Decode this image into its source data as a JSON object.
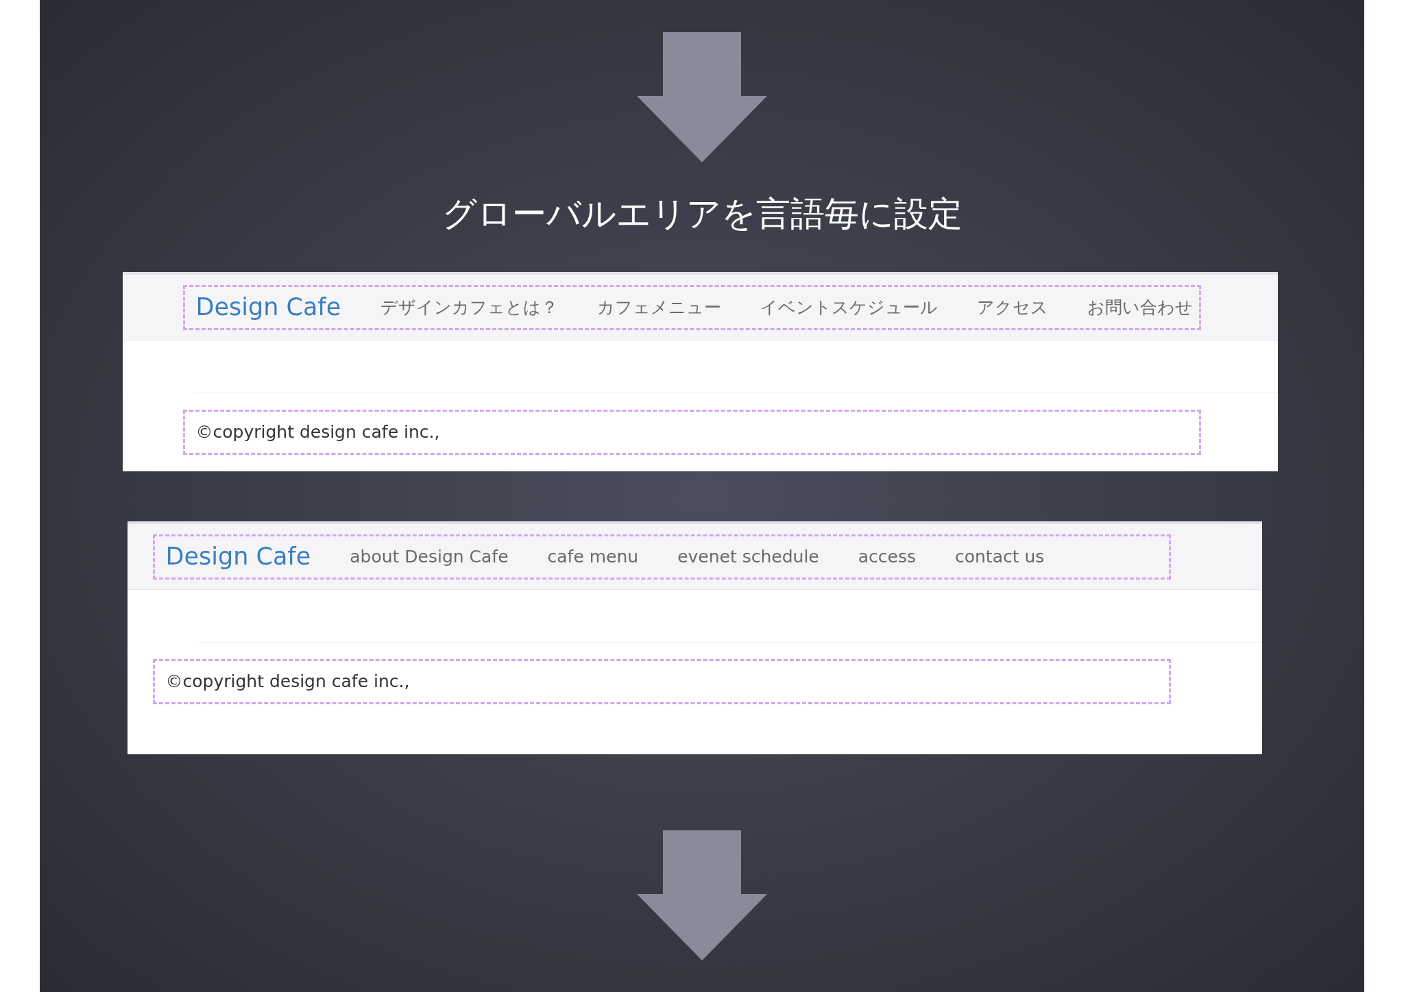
{
  "title": "グローバルエリアを言語毎に設定",
  "panels": [
    {
      "logo": "Design Cafe",
      "nav": [
        "デザインカフェとは？",
        "カフェメニュー",
        "イベントスケジュール",
        "アクセス",
        "お問い合わせ"
      ],
      "copyright": "©copyright design cafe inc.,"
    },
    {
      "logo": "Design Cafe",
      "nav": [
        "about Design Cafe",
        "cafe menu",
        "evenet schedule",
        "access",
        "contact us"
      ],
      "copyright": "©copyright design cafe inc.,"
    }
  ]
}
